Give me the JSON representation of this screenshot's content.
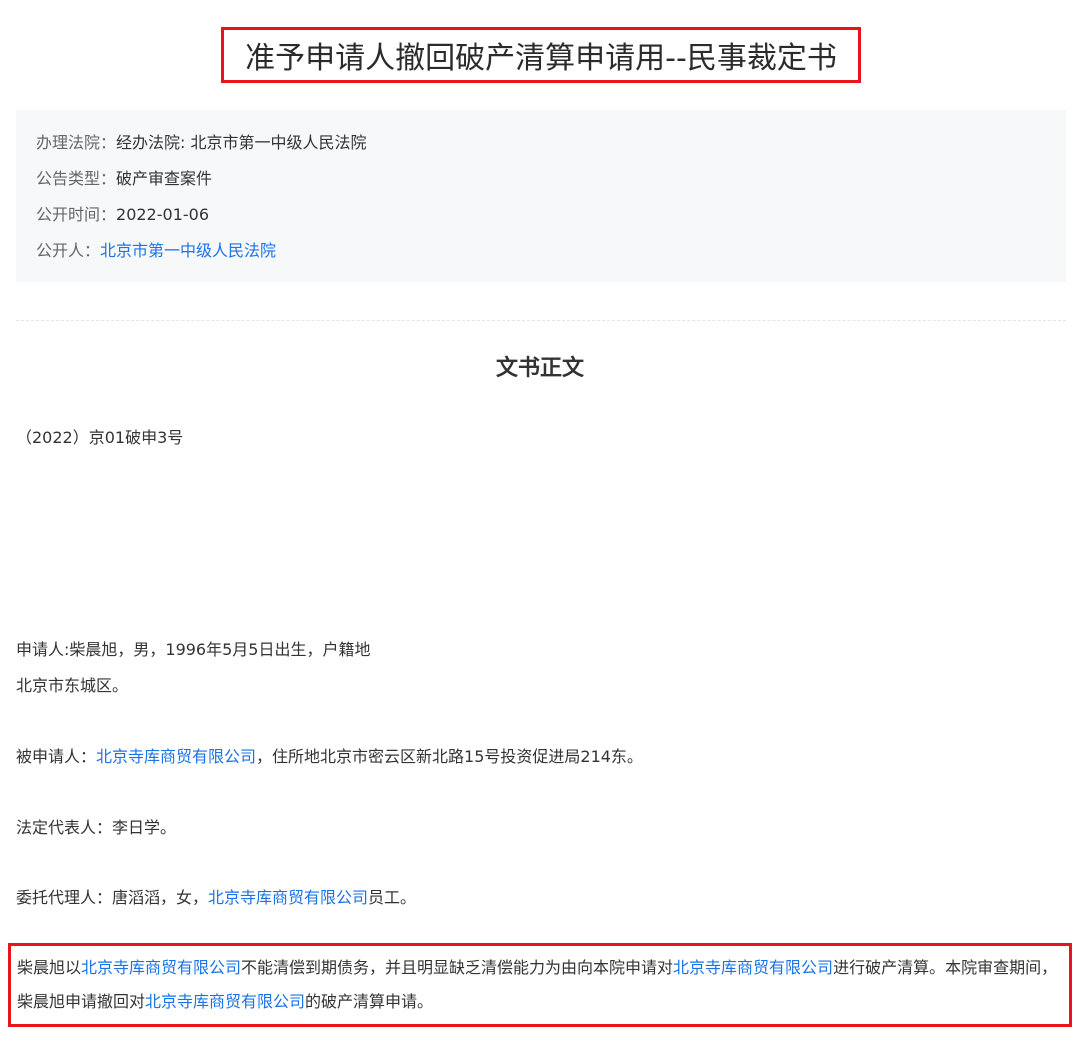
{
  "title": "准予申请人撤回破产清算申请用--民事裁定书",
  "info": {
    "court_label": "办理法院：",
    "court_value": "经办法院: 北京市第一中级人民法院",
    "type_label": "公告类型：",
    "type_value": "破产审查案件",
    "date_label": "公开时间：",
    "date_value": "2022-01-06",
    "publisher_label": "公开人：",
    "publisher_value": "北京市第一中级人民法院"
  },
  "section_heading": "文书正文",
  "doc": {
    "case_number": "（2022）京01破申3号",
    "applicant_line1": "申请人:柴晨旭，男，1996年5月5日出生，户籍地",
    "applicant_line2": "北京市东城区。",
    "respondent_prefix": "被申请人：",
    "respondent_company": "北京寺库商贸有限公司",
    "respondent_suffix": "，住所地北京市密云区新北路15号投资促进局214东。",
    "legal_rep": "法定代表人：李日学。",
    "agent_prefix": "委托代理人：唐滔滔，女，",
    "agent_company": "北京寺库商贸有限公司",
    "agent_suffix": "员工。",
    "conclusion": {
      "p1": "柴晨旭以",
      "company1": "北京寺库商贸有限公司",
      "p2": "不能清偿到期债务，并且明显缺乏清偿能力为由向本院申请对",
      "company2": "北京寺库商贸有限公司",
      "p3": "进行破产清算。本院审查期间，柴晨旭申请撤回对",
      "company3": "北京寺库商贸有限公司",
      "p4": "的破产清算申请。"
    }
  },
  "colors": {
    "link": "#1a73e8",
    "highlight_border": "#e8141b",
    "panel_bg": "#f7f8fa"
  }
}
